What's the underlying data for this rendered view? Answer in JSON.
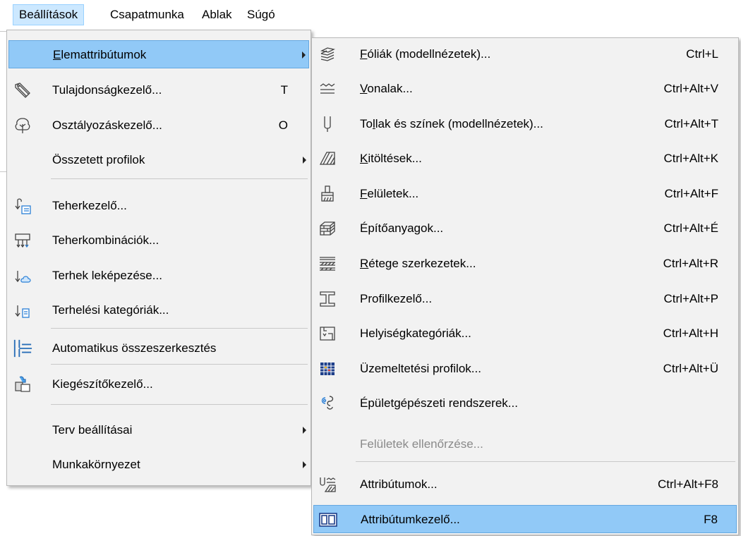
{
  "menubar": [
    {
      "label": "Beállítások",
      "active": true
    },
    {
      "label": "Csapatmunka"
    },
    {
      "label": "Ablak"
    },
    {
      "label": "Súgó"
    }
  ],
  "primary_menu": [
    {
      "pre": "",
      "mn": "E",
      "post": "lemattribútumok",
      "key": "",
      "submenu": true,
      "highlighted": true,
      "icon": "none"
    },
    {
      "pre": "Tulajdonságkezelő...",
      "mn": "",
      "post": "",
      "key": "T",
      "icon": "tag-icon"
    },
    {
      "pre": "Osztályozáskezelő...",
      "mn": "",
      "post": "",
      "key": "O",
      "icon": "tree-icon"
    },
    {
      "pre": "Összetett profilok",
      "mn": "",
      "post": "",
      "key": "",
      "submenu": true,
      "icon": "none"
    },
    {
      "pre": "Teherkezelő...",
      "mn": "",
      "post": "",
      "key": "",
      "icon": "load-manager-icon"
    },
    {
      "pre": "Teherkombinációk...",
      "mn": "",
      "post": "",
      "key": "",
      "icon": "load-combination-icon"
    },
    {
      "pre": "Terhek leképezése...",
      "mn": "",
      "post": "",
      "key": "",
      "icon": "load-mapping-icon"
    },
    {
      "pre": "Terhelési kategóriák...",
      "mn": "",
      "post": "",
      "key": "",
      "icon": "load-category-icon"
    },
    {
      "pre": "Automatikus összeszerkesztés",
      "mn": "",
      "post": "",
      "key": "",
      "icon": "auto-merge-icon"
    },
    {
      "pre": "Kie",
      "mn": "g",
      "post": "észítőkezelő...",
      "key": "",
      "icon": "addon-manager-icon"
    },
    {
      "pre": "Terv beállításai",
      "mn": "",
      "post": "",
      "key": "",
      "submenu": true,
      "icon": "none"
    },
    {
      "pre": "Munkakörnyezet",
      "mn": "",
      "post": "",
      "key": "",
      "submenu": true,
      "icon": "none"
    }
  ],
  "submenu": [
    {
      "pre": "",
      "mn": "F",
      "post": "óliák (modellnézetek)...",
      "key": "Ctrl+L",
      "icon": "layers-icon"
    },
    {
      "pre": "",
      "mn": "V",
      "post": "onalak...",
      "key": "Ctrl+Alt+V",
      "icon": "line-types-icon"
    },
    {
      "pre": "To",
      "mn": "l",
      "post": "lak és színek (modellnézetek)...",
      "key": "Ctrl+Alt+T",
      "icon": "pen-icon"
    },
    {
      "pre": "",
      "mn": "K",
      "post": "itöltések...",
      "key": "Ctrl+Alt+K",
      "icon": "fill-icon"
    },
    {
      "pre": "",
      "mn": "F",
      "post": "elületek...",
      "key": "Ctrl+Alt+F",
      "icon": "surface-brush-icon"
    },
    {
      "pre": "Építőanyagok...",
      "mn": "",
      "post": "",
      "key": "Ctrl+Alt+É",
      "icon": "building-material-icon"
    },
    {
      "pre": "",
      "mn": "R",
      "post": "étege szerkezetek...",
      "key": "Ctrl+Alt+R",
      "icon": "composite-icon"
    },
    {
      "pre": "Profilkezelő...",
      "mn": "",
      "post": "",
      "key": "Ctrl+Alt+P",
      "icon": "profile-icon"
    },
    {
      "pre": "Helyiségkategóriák...",
      "mn": "",
      "post": "",
      "key": "Ctrl+Alt+H",
      "icon": "zone-category-icon"
    },
    {
      "pre": "Üzemeltetési profilok...",
      "mn": "",
      "post": "",
      "key": "Ctrl+Alt+Ü",
      "icon": "operation-profile-icon"
    },
    {
      "pre": "Épületgépészeti rendszerek...",
      "mn": "",
      "post": "",
      "key": "",
      "icon": "mep-system-icon"
    },
    {
      "pre": "Felületek ellenőrzése...",
      "mn": "",
      "post": "",
      "key": "",
      "disabled": true,
      "icon": "none"
    },
    {
      "pre": "Attribútumok...",
      "mn": "",
      "post": "",
      "key": "Ctrl+Alt+F8",
      "icon": "attributes-icon"
    },
    {
      "pre": "Attribútumkezelő...",
      "mn": "",
      "post": "",
      "key": "F8",
      "highlighted": true,
      "icon": "attribute-manager-icon"
    }
  ],
  "colors": {
    "highlight": "#91c9f7",
    "menubar_active": "#cce8ff",
    "menu_bg": "#f2f2f2",
    "disabled_text": "#8a8a8a"
  }
}
